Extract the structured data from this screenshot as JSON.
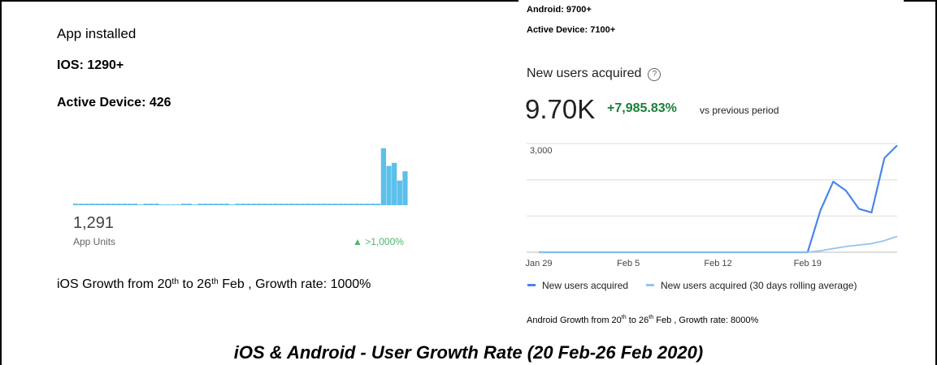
{
  "ios": {
    "heading": "App installed",
    "count_label": "IOS: 1290+",
    "active_label": "Active Device: 426",
    "metric_value": "1,291",
    "metric_label": "App Units",
    "change_label": "▲ >1,000%",
    "growth_pre": "iOS Growth from 20",
    "growth_sup1": "th",
    "growth_mid": " to 26",
    "growth_sup2": "th",
    "growth_post": " Feb , Growth rate: 1000%"
  },
  "android": {
    "count_label": "Android:  9700+",
    "active_label": "Active Device: 7100+",
    "metric_label": "New users acquired",
    "help_icon": "?",
    "big_value": "9.70K",
    "change_pct": "+7,985.83%",
    "change_suffix": "vs previous period",
    "growth_pre": "Android Growth from 20",
    "growth_sup1": "th",
    "growth_mid": " to 26",
    "growth_sup2": "th",
    "growth_post": " Feb , Growth rate: 8000%"
  },
  "caption": "iOS & Android - User Growth Rate (20 Feb-26 Feb 2020)",
  "colors": {
    "ios_bar": "#5bc0eb",
    "android_series": "#4a86e8",
    "android_rolling": "#93c4f0",
    "positive": "#188038"
  },
  "chart_data": [
    {
      "type": "bar",
      "title": "",
      "xlabel": "",
      "ylabel": "",
      "grid": false,
      "values": [
        2,
        2,
        2,
        2,
        2,
        2,
        2,
        2,
        2,
        2,
        2,
        2,
        1,
        2,
        2,
        2,
        1,
        1,
        1,
        1,
        2,
        2,
        1,
        2,
        2,
        2,
        2,
        2,
        2,
        1,
        2,
        2,
        2,
        2,
        2,
        2,
        2,
        2,
        2,
        2,
        2,
        2,
        2,
        2,
        2,
        2,
        2,
        2,
        2,
        2,
        2,
        2,
        2,
        2,
        2,
        2,
        2,
        74,
        51,
        55,
        32,
        44
      ],
      "ylim": [
        0,
        80
      ]
    },
    {
      "type": "line",
      "title": "",
      "x": [
        "Jan 29",
        "Jan 30",
        "Jan 31",
        "Feb 1",
        "Feb 2",
        "Feb 3",
        "Feb 4",
        "Feb 5",
        "Feb 6",
        "Feb 7",
        "Feb 8",
        "Feb 9",
        "Feb 10",
        "Feb 11",
        "Feb 12",
        "Feb 13",
        "Feb 14",
        "Feb 15",
        "Feb 16",
        "Feb 17",
        "Feb 18",
        "Feb 19",
        "Feb 20",
        "Feb 21",
        "Feb 22",
        "Feb 23",
        "Feb 24",
        "Feb 25",
        "Feb 26"
      ],
      "x_ticks": [
        "Jan 29",
        "Feb 5",
        "Feb 12",
        "Feb 19"
      ],
      "y_ticks": [
        "3,000"
      ],
      "ylim": [
        0,
        3000
      ],
      "grid": true,
      "legend_position": "bottom",
      "series": [
        {
          "name": "New users acquired",
          "values": [
            0,
            0,
            0,
            0,
            0,
            0,
            0,
            0,
            0,
            0,
            0,
            0,
            0,
            0,
            0,
            0,
            0,
            0,
            0,
            0,
            0,
            0,
            1150,
            1950,
            1700,
            1200,
            1100,
            2600,
            null
          ]
        },
        {
          "name": "New users acquired (30 days rolling average)",
          "values": [
            0,
            0,
            0,
            0,
            0,
            0,
            0,
            0,
            0,
            0,
            0,
            0,
            0,
            0,
            0,
            0,
            0,
            0,
            0,
            0,
            0,
            0,
            40,
            100,
            160,
            200,
            240,
            320,
            null
          ]
        }
      ]
    }
  ]
}
